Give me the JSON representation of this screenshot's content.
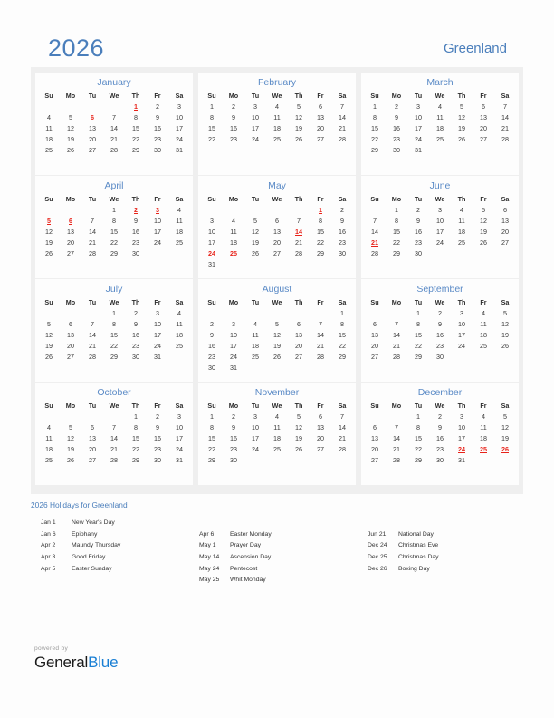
{
  "header": {
    "year": "2026",
    "country": "Greenland"
  },
  "weekday_headers": [
    "Su",
    "Mo",
    "Tu",
    "We",
    "Th",
    "Fr",
    "Sa"
  ],
  "colors": {
    "accent_blue": "#4a7ebb",
    "month_title_blue": "#5a8ac6",
    "holiday_red": "#e8231a",
    "panel_background": "#efefef",
    "card_background": "#fdfdfd",
    "page_background": "#fdfdfd",
    "brand_blue": "#1a7fd4"
  },
  "months": [
    {
      "name": "January",
      "weeks": [
        [
          "",
          "",
          "",
          "",
          "1",
          "2",
          "3"
        ],
        [
          "4",
          "5",
          "6",
          "7",
          "8",
          "9",
          "10"
        ],
        [
          "11",
          "12",
          "13",
          "14",
          "15",
          "16",
          "17"
        ],
        [
          "18",
          "19",
          "20",
          "21",
          "22",
          "23",
          "24"
        ],
        [
          "25",
          "26",
          "27",
          "28",
          "29",
          "30",
          "31"
        ],
        [
          "",
          "",
          "",
          "",
          "",
          "",
          ""
        ]
      ],
      "holidays": [
        "1",
        "6"
      ]
    },
    {
      "name": "February",
      "weeks": [
        [
          "1",
          "2",
          "3",
          "4",
          "5",
          "6",
          "7"
        ],
        [
          "8",
          "9",
          "10",
          "11",
          "12",
          "13",
          "14"
        ],
        [
          "15",
          "16",
          "17",
          "18",
          "19",
          "20",
          "21"
        ],
        [
          "22",
          "23",
          "24",
          "25",
          "26",
          "27",
          "28"
        ],
        [
          "",
          "",
          "",
          "",
          "",
          "",
          ""
        ],
        [
          "",
          "",
          "",
          "",
          "",
          "",
          ""
        ]
      ],
      "holidays": []
    },
    {
      "name": "March",
      "weeks": [
        [
          "1",
          "2",
          "3",
          "4",
          "5",
          "6",
          "7"
        ],
        [
          "8",
          "9",
          "10",
          "11",
          "12",
          "13",
          "14"
        ],
        [
          "15",
          "16",
          "17",
          "18",
          "19",
          "20",
          "21"
        ],
        [
          "22",
          "23",
          "24",
          "25",
          "26",
          "27",
          "28"
        ],
        [
          "29",
          "30",
          "31",
          "",
          "",
          "",
          ""
        ],
        [
          "",
          "",
          "",
          "",
          "",
          "",
          ""
        ]
      ],
      "holidays": []
    },
    {
      "name": "April",
      "weeks": [
        [
          "",
          "",
          "",
          "1",
          "2",
          "3",
          "4"
        ],
        [
          "5",
          "6",
          "7",
          "8",
          "9",
          "10",
          "11"
        ],
        [
          "12",
          "13",
          "14",
          "15",
          "16",
          "17",
          "18"
        ],
        [
          "19",
          "20",
          "21",
          "22",
          "23",
          "24",
          "25"
        ],
        [
          "26",
          "27",
          "28",
          "29",
          "30",
          "",
          ""
        ],
        [
          "",
          "",
          "",
          "",
          "",
          "",
          ""
        ]
      ],
      "holidays": [
        "2",
        "3",
        "5",
        "6"
      ]
    },
    {
      "name": "May",
      "weeks": [
        [
          "",
          "",
          "",
          "",
          "",
          "1",
          "2"
        ],
        [
          "3",
          "4",
          "5",
          "6",
          "7",
          "8",
          "9"
        ],
        [
          "10",
          "11",
          "12",
          "13",
          "14",
          "15",
          "16"
        ],
        [
          "17",
          "18",
          "19",
          "20",
          "21",
          "22",
          "23"
        ],
        [
          "24",
          "25",
          "26",
          "27",
          "28",
          "29",
          "30"
        ],
        [
          "31",
          "",
          "",
          "",
          "",
          "",
          ""
        ]
      ],
      "holidays": [
        "1",
        "14",
        "24",
        "25"
      ]
    },
    {
      "name": "June",
      "weeks": [
        [
          "",
          "1",
          "2",
          "3",
          "4",
          "5",
          "6"
        ],
        [
          "7",
          "8",
          "9",
          "10",
          "11",
          "12",
          "13"
        ],
        [
          "14",
          "15",
          "16",
          "17",
          "18",
          "19",
          "20"
        ],
        [
          "21",
          "22",
          "23",
          "24",
          "25",
          "26",
          "27"
        ],
        [
          "28",
          "29",
          "30",
          "",
          "",
          "",
          ""
        ],
        [
          "",
          "",
          "",
          "",
          "",
          "",
          ""
        ]
      ],
      "holidays": [
        "21"
      ]
    },
    {
      "name": "July",
      "weeks": [
        [
          "",
          "",
          "",
          "1",
          "2",
          "3",
          "4"
        ],
        [
          "5",
          "6",
          "7",
          "8",
          "9",
          "10",
          "11"
        ],
        [
          "12",
          "13",
          "14",
          "15",
          "16",
          "17",
          "18"
        ],
        [
          "19",
          "20",
          "21",
          "22",
          "23",
          "24",
          "25"
        ],
        [
          "26",
          "27",
          "28",
          "29",
          "30",
          "31",
          ""
        ],
        [
          "",
          "",
          "",
          "",
          "",
          "",
          ""
        ]
      ],
      "holidays": []
    },
    {
      "name": "August",
      "weeks": [
        [
          "",
          "",
          "",
          "",
          "",
          "",
          "1"
        ],
        [
          "2",
          "3",
          "4",
          "5",
          "6",
          "7",
          "8"
        ],
        [
          "9",
          "10",
          "11",
          "12",
          "13",
          "14",
          "15"
        ],
        [
          "16",
          "17",
          "18",
          "19",
          "20",
          "21",
          "22"
        ],
        [
          "23",
          "24",
          "25",
          "26",
          "27",
          "28",
          "29"
        ],
        [
          "30",
          "31",
          "",
          "",
          "",
          "",
          ""
        ]
      ],
      "holidays": []
    },
    {
      "name": "September",
      "weeks": [
        [
          "",
          "",
          "1",
          "2",
          "3",
          "4",
          "5"
        ],
        [
          "6",
          "7",
          "8",
          "9",
          "10",
          "11",
          "12"
        ],
        [
          "13",
          "14",
          "15",
          "16",
          "17",
          "18",
          "19"
        ],
        [
          "20",
          "21",
          "22",
          "23",
          "24",
          "25",
          "26"
        ],
        [
          "27",
          "28",
          "29",
          "30",
          "",
          "",
          ""
        ],
        [
          "",
          "",
          "",
          "",
          "",
          "",
          ""
        ]
      ],
      "holidays": []
    },
    {
      "name": "October",
      "weeks": [
        [
          "",
          "",
          "",
          "",
          "1",
          "2",
          "3"
        ],
        [
          "4",
          "5",
          "6",
          "7",
          "8",
          "9",
          "10"
        ],
        [
          "11",
          "12",
          "13",
          "14",
          "15",
          "16",
          "17"
        ],
        [
          "18",
          "19",
          "20",
          "21",
          "22",
          "23",
          "24"
        ],
        [
          "25",
          "26",
          "27",
          "28",
          "29",
          "30",
          "31"
        ],
        [
          "",
          "",
          "",
          "",
          "",
          "",
          ""
        ]
      ],
      "holidays": []
    },
    {
      "name": "November",
      "weeks": [
        [
          "1",
          "2",
          "3",
          "4",
          "5",
          "6",
          "7"
        ],
        [
          "8",
          "9",
          "10",
          "11",
          "12",
          "13",
          "14"
        ],
        [
          "15",
          "16",
          "17",
          "18",
          "19",
          "20",
          "21"
        ],
        [
          "22",
          "23",
          "24",
          "25",
          "26",
          "27",
          "28"
        ],
        [
          "29",
          "30",
          "",
          "",
          "",
          "",
          ""
        ],
        [
          "",
          "",
          "",
          "",
          "",
          "",
          ""
        ]
      ],
      "holidays": []
    },
    {
      "name": "December",
      "weeks": [
        [
          "",
          "",
          "1",
          "2",
          "3",
          "4",
          "5"
        ],
        [
          "6",
          "7",
          "8",
          "9",
          "10",
          "11",
          "12"
        ],
        [
          "13",
          "14",
          "15",
          "16",
          "17",
          "18",
          "19"
        ],
        [
          "20",
          "21",
          "22",
          "23",
          "24",
          "25",
          "26"
        ],
        [
          "27",
          "28",
          "29",
          "30",
          "31",
          "",
          ""
        ],
        [
          "",
          "",
          "",
          "",
          "",
          "",
          ""
        ]
      ],
      "holidays": [
        "24",
        "25",
        "26"
      ]
    }
  ],
  "holidays_section": {
    "heading": "2026 Holidays for Greenland",
    "columns": [
      {
        "offset": 0,
        "entries": [
          {
            "date": "Jan 1",
            "name": "New Year's Day"
          },
          {
            "date": "Jan 6",
            "name": "Epiphany"
          },
          {
            "date": "Apr 2",
            "name": "Maundy Thursday"
          },
          {
            "date": "Apr 3",
            "name": "Good Friday"
          },
          {
            "date": "Apr 5",
            "name": "Easter Sunday"
          }
        ]
      },
      {
        "offset": 1,
        "entries": [
          {
            "date": "Apr 6",
            "name": "Easter Monday"
          },
          {
            "date": "May 1",
            "name": "Prayer Day"
          },
          {
            "date": "May 14",
            "name": "Ascension Day"
          },
          {
            "date": "May 24",
            "name": "Pentecost"
          },
          {
            "date": "May 25",
            "name": "Whit Monday"
          }
        ]
      },
      {
        "offset": 1,
        "entries": [
          {
            "date": "Jun 21",
            "name": "National Day"
          },
          {
            "date": "Dec 24",
            "name": "Christmas Eve"
          },
          {
            "date": "Dec 25",
            "name": "Christmas Day"
          },
          {
            "date": "Dec 26",
            "name": "Boxing Day"
          }
        ]
      }
    ]
  },
  "footer": {
    "powered_by": "powered by",
    "brand_first": "General",
    "brand_second": "Blue"
  }
}
